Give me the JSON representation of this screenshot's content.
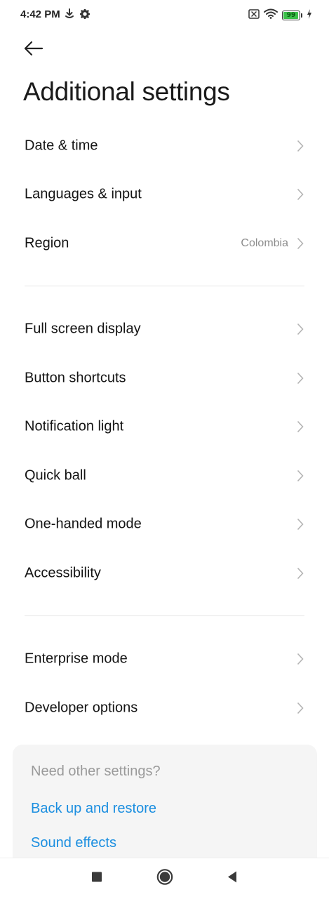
{
  "status_bar": {
    "time": "4:42 PM",
    "battery_level": "99",
    "icons": [
      "download-icon",
      "gear-icon",
      "sim-disabled-icon",
      "wifi-icon",
      "battery-icon",
      "charging-icon"
    ]
  },
  "header": {
    "back_icon": "arrow-left-icon",
    "title": "Additional settings"
  },
  "groups": [
    {
      "items": [
        {
          "label": "Date & time",
          "value": ""
        },
        {
          "label": "Languages & input",
          "value": ""
        },
        {
          "label": "Region",
          "value": "Colombia"
        }
      ]
    },
    {
      "items": [
        {
          "label": "Full screen display",
          "value": ""
        },
        {
          "label": "Button shortcuts",
          "value": ""
        },
        {
          "label": "Notification light",
          "value": ""
        },
        {
          "label": "Quick ball",
          "value": ""
        },
        {
          "label": "One-handed mode",
          "value": ""
        },
        {
          "label": "Accessibility",
          "value": ""
        }
      ]
    },
    {
      "items": [
        {
          "label": "Enterprise mode",
          "value": ""
        },
        {
          "label": "Developer options",
          "value": ""
        }
      ]
    }
  ],
  "suggestions": {
    "heading": "Need other settings?",
    "links": [
      "Back up and restore",
      "Sound effects"
    ]
  },
  "nav_bar": {
    "buttons": [
      "recents-square-icon",
      "home-circle-icon",
      "back-triangle-icon"
    ]
  },
  "colors": {
    "accent_link": "#1a8ee0",
    "battery_fill": "#3cc04a",
    "secondary_text": "#8c8c8c"
  }
}
